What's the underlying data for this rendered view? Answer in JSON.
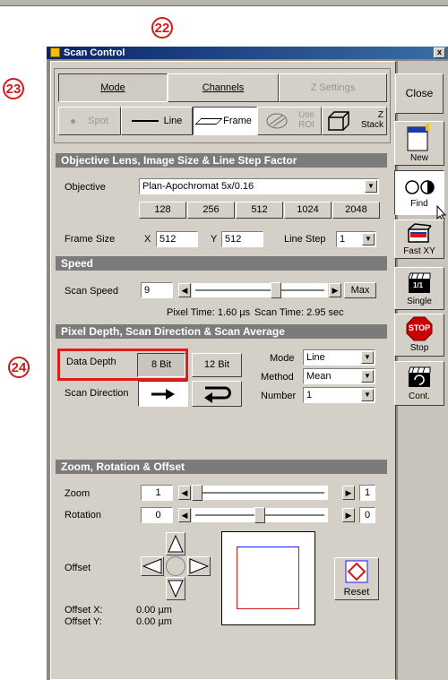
{
  "callouts": [
    "22",
    "23",
    "24"
  ],
  "window": {
    "title": "Scan Control",
    "close_glyph": "x"
  },
  "tabs": [
    {
      "label": "Mode"
    },
    {
      "label": "Channels"
    },
    {
      "label": "Z Settings"
    }
  ],
  "close_button": "Close",
  "scan_types": [
    {
      "label": "Spot"
    },
    {
      "label": "Line"
    },
    {
      "label": "Frame"
    },
    {
      "label": "Use ROI"
    },
    {
      "label": "Z Stack"
    }
  ],
  "toolbar": [
    {
      "label": "New",
      "icon": "new-document-icon"
    },
    {
      "label": "Find",
      "icon": "find-icon"
    },
    {
      "label": "Fast XY",
      "icon": "fast-xy-icon"
    },
    {
      "label": "Single",
      "icon": "single-scan-icon",
      "glyph": "1/1"
    },
    {
      "label": "Stop",
      "icon": "stop-sign-icon",
      "sign": "STOP"
    },
    {
      "label": "Cont.",
      "icon": "continuous-scan-icon"
    }
  ],
  "objective_section": {
    "title": "Objective Lens, Image Size & Line Step Factor",
    "objective_label": "Objective",
    "objective_value": "Plan-Apochromat 5x/0.16",
    "presets": [
      "128",
      "256",
      "512",
      "1024",
      "2048"
    ],
    "frame_size_label": "Frame Size",
    "x_label": "X",
    "x_value": "512",
    "y_label": "Y",
    "y_value": "512",
    "line_step_label": "Line Step",
    "line_step_value": "1"
  },
  "speed_section": {
    "title": "Speed",
    "scan_speed_label": "Scan Speed",
    "scan_speed_value": "9",
    "slider_level": 0.63,
    "max_label": "Max",
    "pixel_time": "Pixel Time: 1.60 µs",
    "scan_time": "Scan Time: 2.95 sec"
  },
  "pixel_section": {
    "title": "Pixel Depth, Scan Direction & Scan Average",
    "data_depth_label": "Data Depth",
    "bit8": "8 Bit",
    "bit12": "12 Bit",
    "scan_direction_label": "Scan Direction",
    "mode_label": "Mode",
    "mode_value": "Line",
    "method_label": "Method",
    "method_value": "Mean",
    "number_label": "Number",
    "number_value": "1"
  },
  "zoom_section": {
    "title": "Zoom, Rotation & Offset",
    "zoom_label": "Zoom",
    "zoom_value": "1",
    "zoom_level": 0.0,
    "zoom_max": "1",
    "rotation_label": "Rotation",
    "rotation_value": "0",
    "rotation_level": 0.5,
    "rotation_max": "0",
    "offset_label": "Offset",
    "reset_label": "Reset",
    "offset_x_label": "Offset X:",
    "offset_x_value": "0.00 µm",
    "offset_y_label": "Offset Y:",
    "offset_y_value": "0.00 µm"
  },
  "colors": {
    "callout": "#d21a1a",
    "highlight": "#e11a1a",
    "title_bar": "#0a246a",
    "stop": "#cc0000"
  }
}
